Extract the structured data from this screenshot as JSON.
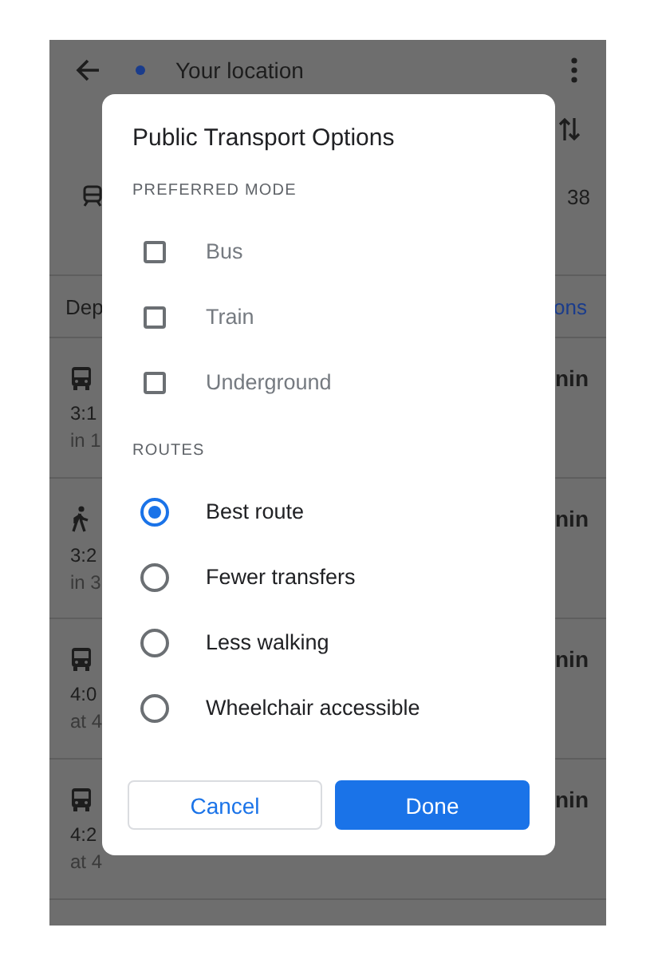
{
  "app_bar": {
    "origin": "Your location"
  },
  "trip_summary": {
    "fragment": "38"
  },
  "departure_bar": {
    "left_fragment": "Dep",
    "right_fragment": "ons"
  },
  "routes": [
    {
      "kind": "bus",
      "time": "3:1",
      "detail": "in 1",
      "duration": "nin"
    },
    {
      "kind": "walk",
      "time": "3:2",
      "detail": "in 3",
      "duration": "nin"
    },
    {
      "kind": "bus",
      "time": "4:0",
      "detail": "at 4",
      "duration": "nin"
    },
    {
      "kind": "bus",
      "time": "4:2",
      "detail": "at 4",
      "duration": "nin"
    }
  ],
  "dialog": {
    "title": "Public Transport Options",
    "sections": [
      {
        "heading": "PREFERRED MODE",
        "kind": "checkbox",
        "options": [
          {
            "label": "Bus",
            "checked": false
          },
          {
            "label": "Train",
            "checked": false
          },
          {
            "label": "Underground",
            "checked": false
          }
        ]
      },
      {
        "heading": "ROUTES",
        "kind": "radio",
        "options": [
          {
            "label": "Best route",
            "selected": true
          },
          {
            "label": "Fewer transfers",
            "selected": false
          },
          {
            "label": "Less walking",
            "selected": false
          },
          {
            "label": "Wheelchair accessible",
            "selected": false
          }
        ]
      }
    ],
    "buttons": [
      {
        "label": "Cancel",
        "kind": "secondary"
      },
      {
        "label": "Done",
        "kind": "primary"
      }
    ]
  }
}
